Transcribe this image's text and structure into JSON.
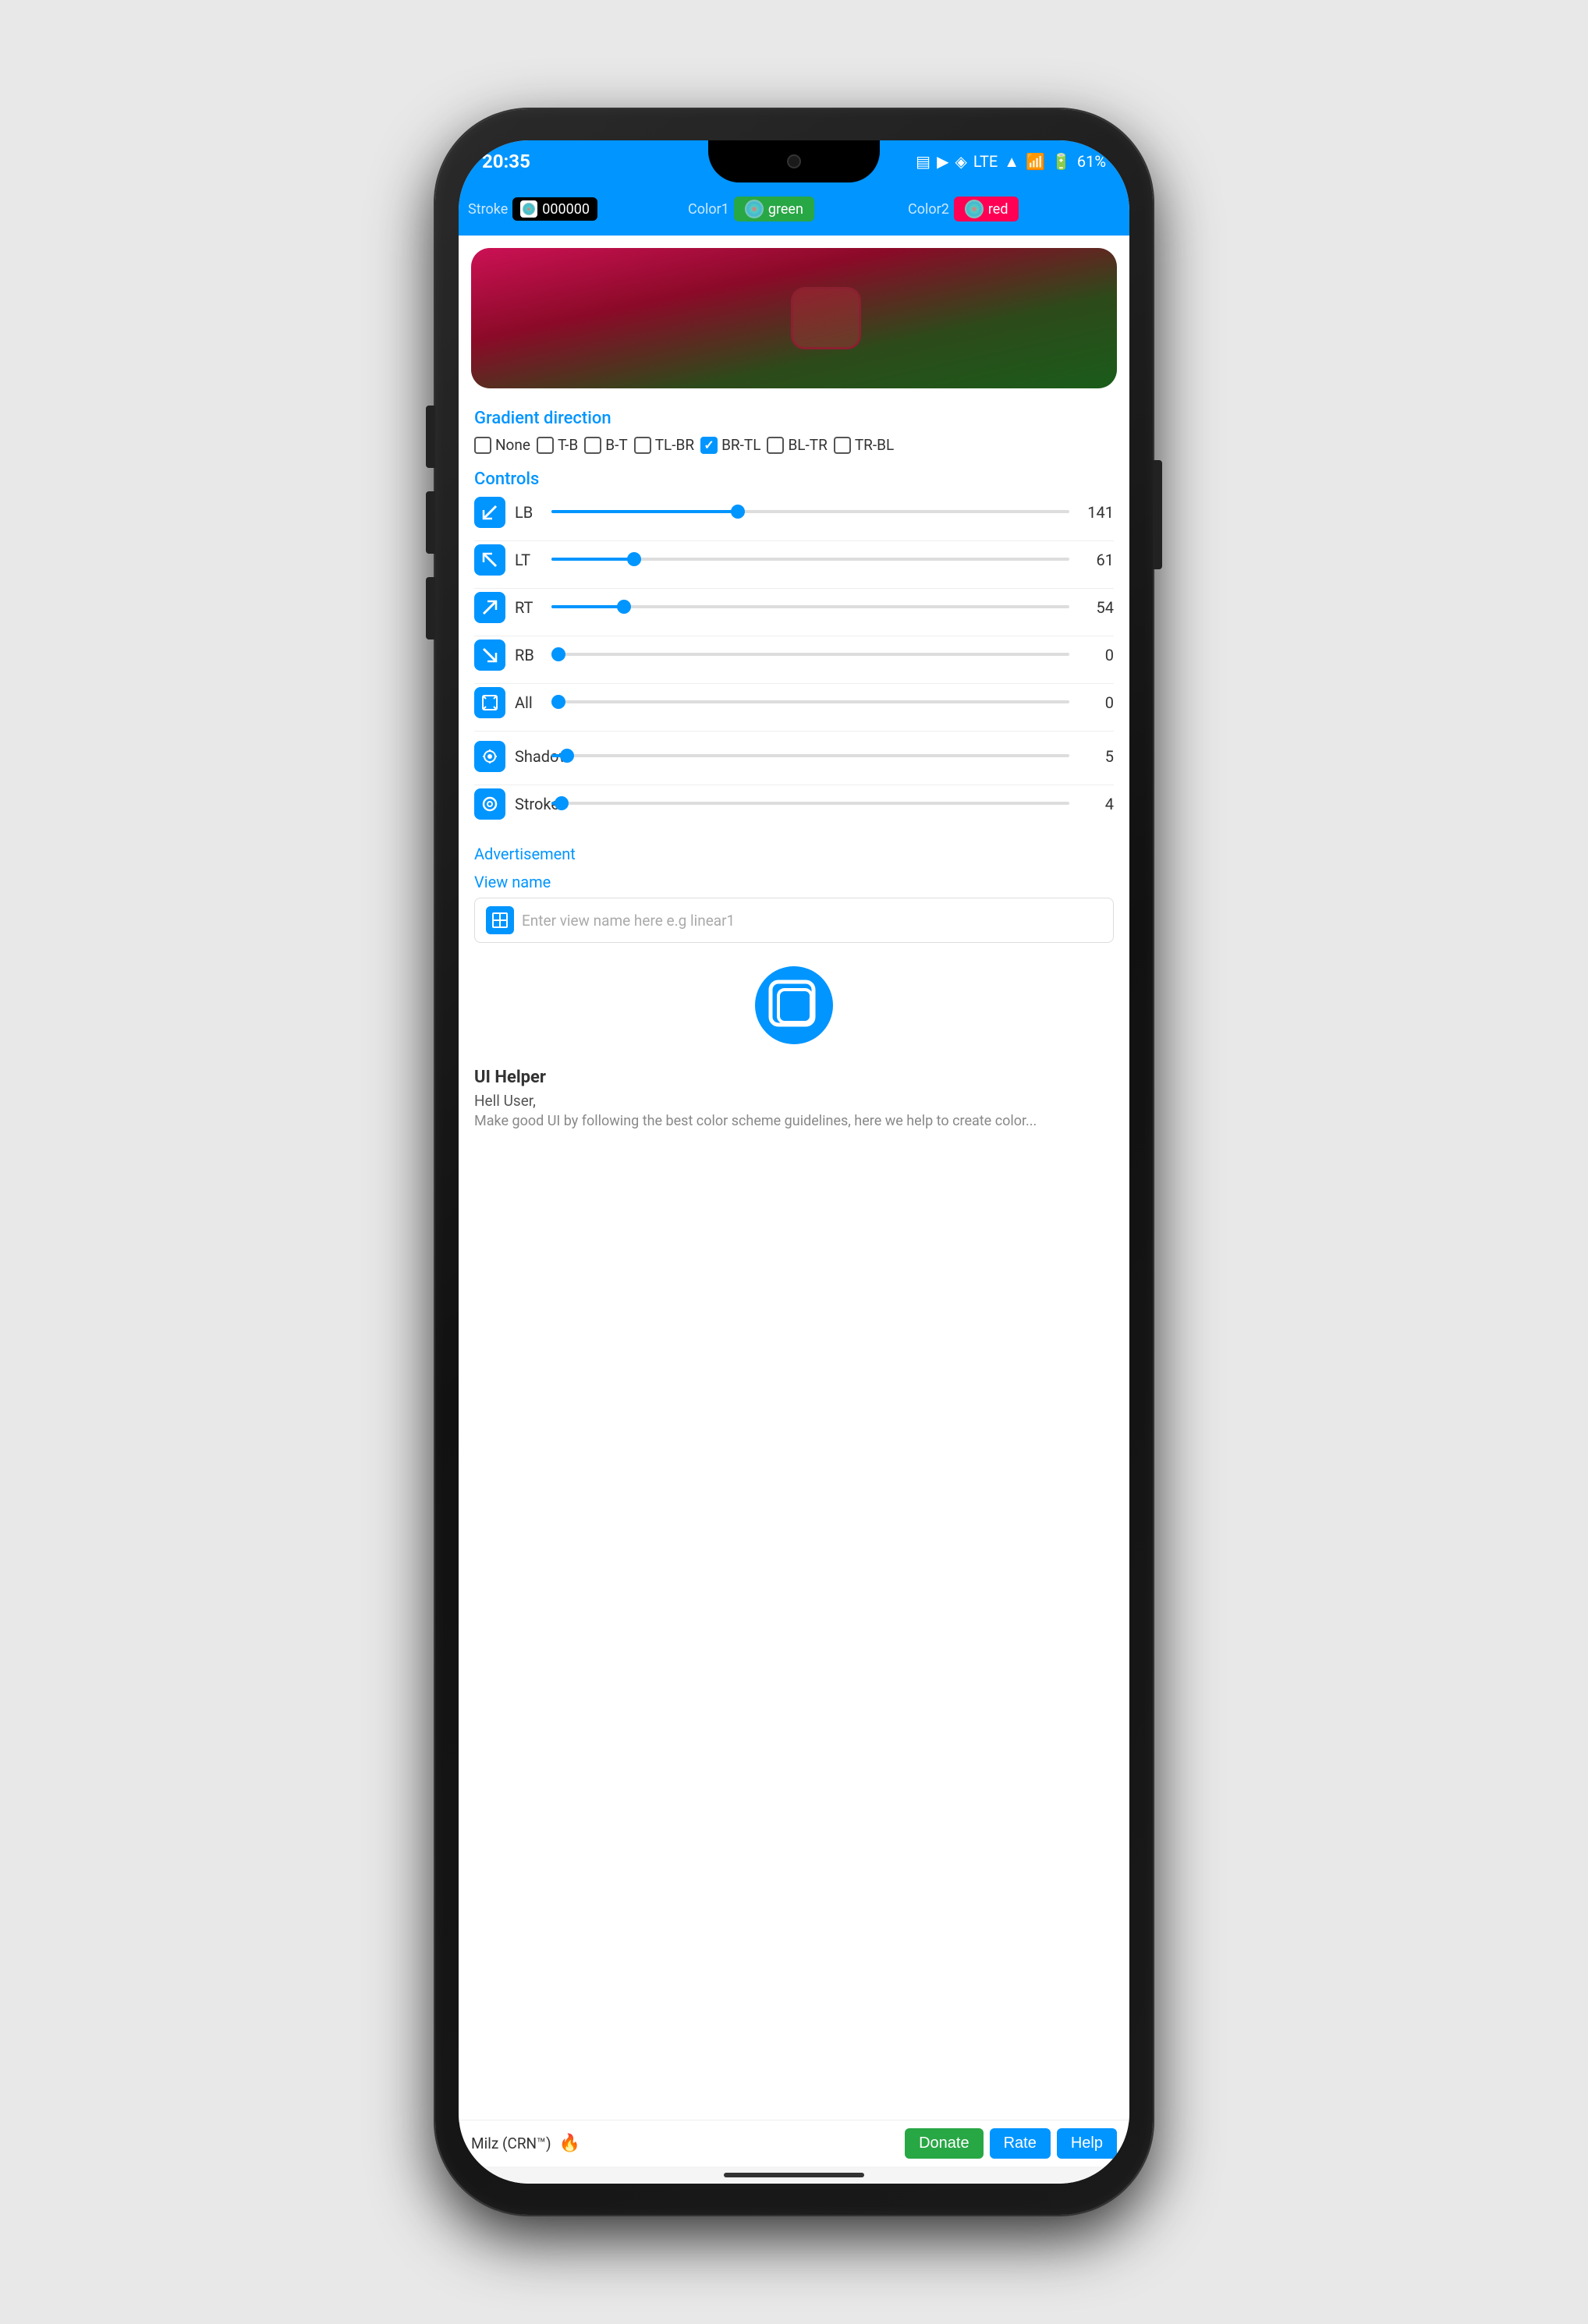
{
  "phone": {
    "status_bar": {
      "time": "20:35",
      "battery": "61%",
      "network": "LTE"
    },
    "toolbar": {
      "stroke_label": "Stroke",
      "stroke_color": "000000",
      "color1_label": "Color1",
      "color1_value": "green",
      "color2_label": "Color2",
      "color2_value": "red"
    },
    "gradient_section": {
      "title": "Gradient direction",
      "options": [
        {
          "label": "None",
          "checked": false
        },
        {
          "label": "T-B",
          "checked": false
        },
        {
          "label": "B-T",
          "checked": false
        },
        {
          "label": "TL-BR",
          "checked": false
        },
        {
          "label": "BR-TL",
          "checked": true
        },
        {
          "label": "BL-TR",
          "checked": false
        },
        {
          "label": "TR-BL",
          "checked": false
        }
      ]
    },
    "controls": {
      "title": "Controls",
      "sliders": [
        {
          "id": "lb",
          "label": "LB",
          "value": 141,
          "percent": 36
        },
        {
          "id": "lt",
          "label": "LT",
          "value": 61,
          "percent": 16
        },
        {
          "id": "rt",
          "label": "RT",
          "value": 54,
          "percent": 14
        },
        {
          "id": "rb",
          "label": "RB",
          "value": 0,
          "percent": 0
        },
        {
          "id": "all",
          "label": "All",
          "value": 0,
          "percent": 0
        }
      ],
      "extra_sliders": [
        {
          "id": "shadow",
          "label": "Shadow",
          "value": 5,
          "percent": 3
        },
        {
          "id": "stroke",
          "label": "Stroke",
          "value": 4,
          "percent": 2
        }
      ]
    },
    "advertisement": {
      "label": "Advertisement"
    },
    "view_name": {
      "label": "View name",
      "placeholder": "Enter view name here e.g linear1"
    },
    "ui_helper": {
      "title": "UI Helper",
      "greeting": "Hell User,",
      "body_text": "Make good UI by following the best color scheme guidelines, here we help to create color..."
    },
    "bottom_bar": {
      "author": "Milz (CRN™)",
      "donate_label": "Donate",
      "rate_label": "Rate",
      "help_label": "Help"
    }
  }
}
